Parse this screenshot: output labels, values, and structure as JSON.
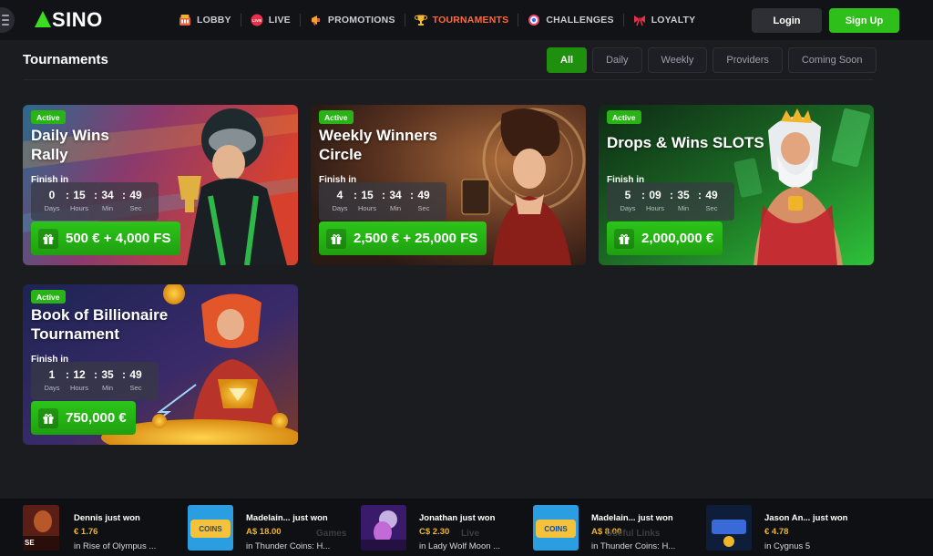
{
  "header": {
    "logo_text": "SINO",
    "nav": [
      {
        "label": "LOBBY",
        "icon": "casino-icon"
      },
      {
        "label": "LIVE",
        "icon": "live-icon"
      },
      {
        "label": "PROMOTIONS",
        "icon": "megaphone-icon"
      },
      {
        "label": "TOURNAMENTS",
        "icon": "trophy-icon"
      },
      {
        "label": "CHALLENGES",
        "icon": "target-icon"
      },
      {
        "label": "LOYALTY",
        "icon": "ribbon-icon"
      }
    ],
    "login_label": "Login",
    "signup_label": "Sign Up",
    "accent": "#ff6a3d",
    "brand_green": "#2fbf1a"
  },
  "page": {
    "title": "Tournaments",
    "filters": [
      "All",
      "Daily",
      "Weekly",
      "Providers",
      "Coming Soon"
    ],
    "active_filter": "All"
  },
  "tournaments": [
    {
      "status": "Active",
      "title": "Daily Wins\nRally",
      "finish_label": "Finish in",
      "timer": {
        "days": "0",
        "hours": "15",
        "min": "34",
        "sec": "49"
      },
      "prize": "500 € + 4,000 FS"
    },
    {
      "status": "Active",
      "title": "Weekly Winners\nCircle",
      "finish_label": "Finish in",
      "timer": {
        "days": "4",
        "hours": "15",
        "min": "34",
        "sec": "49"
      },
      "prize": "2,500 € + 25,000 FS"
    },
    {
      "status": "Active",
      "title": "Drops & Wins SLOTS",
      "finish_label": "Finish in",
      "timer": {
        "days": "5",
        "hours": "09",
        "min": "35",
        "sec": "49"
      },
      "prize": "2,000,000 €"
    },
    {
      "status": "Active",
      "title": "Book of Billionaire\nTournament",
      "finish_label": "Finish in",
      "timer": {
        "days": "1",
        "hours": "12",
        "min": "35",
        "sec": "49"
      },
      "prize": "750,000 €"
    }
  ],
  "timer_labels": {
    "days": "Days",
    "hours": "Hours",
    "min": "Min",
    "sec": "Sec"
  },
  "feed": [
    {
      "who": "Dennis just won",
      "amount": "€ 1.76",
      "game": "in Rise of Olympus ..."
    },
    {
      "who": "Madelain... just won",
      "amount": "A$ 18.00",
      "game": "in Thunder Coins: H..."
    },
    {
      "who": "Jonathan just won",
      "amount": "C$ 2.30",
      "game": "in Lady Wolf Moon ..."
    },
    {
      "who": "Madelain... just won",
      "amount": "A$ 8.00",
      "game": "in Thunder Coins: H..."
    },
    {
      "who": "Jason An... just won",
      "amount": "€ 4.78",
      "game": "in Cygnus 5"
    }
  ],
  "footer_ghost": {
    "games": "Games",
    "live": "Live",
    "useful": "Useful Links"
  }
}
